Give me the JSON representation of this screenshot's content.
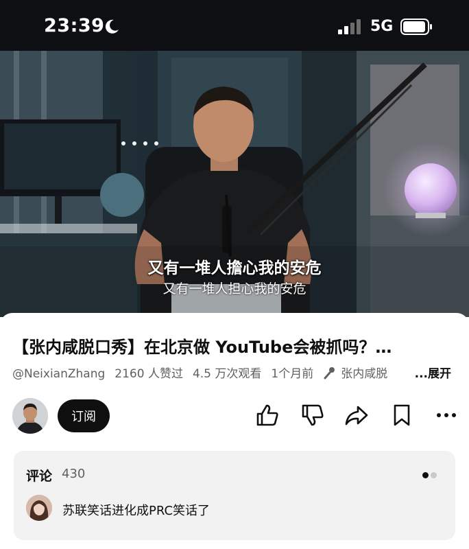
{
  "status_bar": {
    "time": "23:39",
    "network": "5G",
    "signal_bars": 2,
    "battery_level": 0.9
  },
  "video": {
    "subtitle_primary": "又有一堆人擔心我的安危",
    "subtitle_secondary": "又有一堆人担心我的安危"
  },
  "video_info": {
    "title": "【张内咸脱口秀】在北京做 YouTube会被抓吗？…",
    "channel_handle": "@NeixianZhang",
    "likes": "2160 人赞过",
    "views": "4.5 万次观看",
    "published": "1个月前",
    "playlist": "张内咸脱",
    "expand_label": "...展开"
  },
  "channel": {
    "subscribe_label": "订阅"
  },
  "actions": {
    "like_icon": "thumbs-up-icon",
    "dislike_icon": "thumbs-down-icon",
    "share_icon": "share-icon",
    "save_icon": "bookmark-icon",
    "more_icon": "more-icon"
  },
  "comments": {
    "heading": "评论",
    "count": "430",
    "top_comment": "苏联笑话进化成PRC笑话了",
    "page_dots": 2,
    "active_dot": 0
  },
  "colors": {
    "accent_dark": "#0f0f0f",
    "secondary_text": "#606060",
    "comment_bg": "#f2f2f2"
  }
}
